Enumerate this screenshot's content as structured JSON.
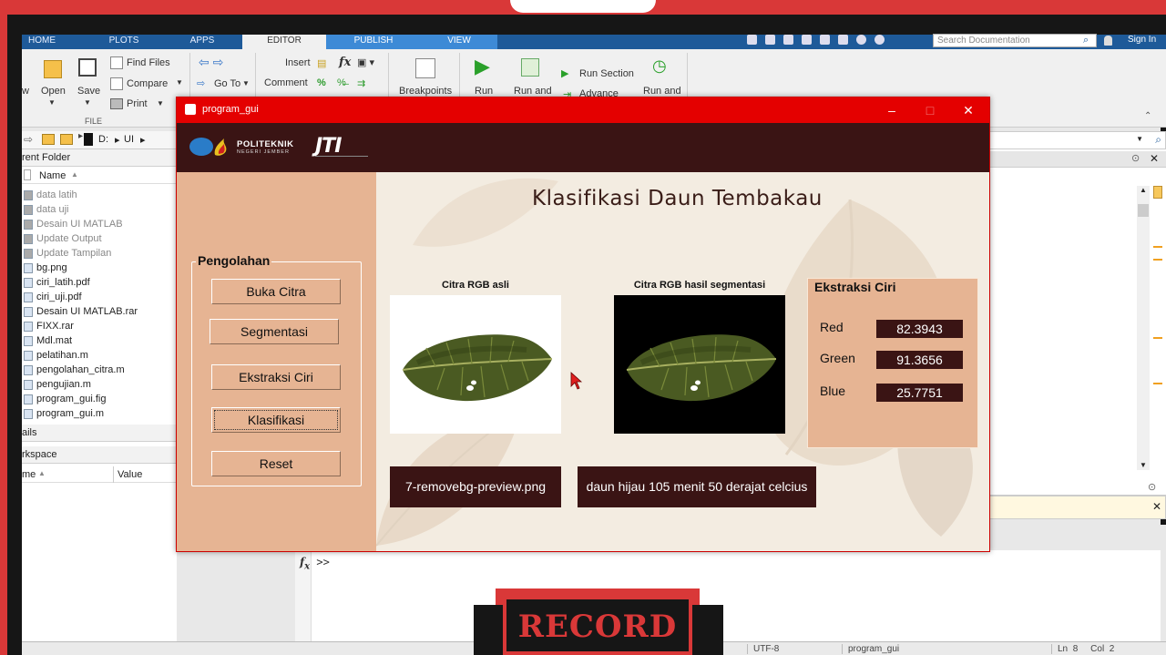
{
  "matlab": {
    "ribbon_tabs": [
      "HOME",
      "PLOTS",
      "APPS",
      "EDITOR",
      "PUBLISH",
      "VIEW"
    ],
    "search_placeholder": "Search Documentation",
    "sign_in": "Sign In",
    "file_group": {
      "new_partial": "w",
      "open": "Open",
      "save": "Save",
      "find_files": "Find Files",
      "compare": "Compare",
      "print": "Print",
      "group_label": "FILE"
    },
    "navigate": {
      "go_to": "Go To"
    },
    "edit": {
      "insert": "Insert",
      "comment": "Comment",
      "fx": "fx"
    },
    "breakpoints": "Breakpoints",
    "run": {
      "run": "Run",
      "run_and_advance": "Run and",
      "run_section": "Run Section",
      "advance": "Advance",
      "run_and_time": "Run and"
    },
    "address": {
      "drive": "D:",
      "folder": "UI"
    },
    "current_folder": {
      "header": "rent Folder",
      "name_col": "Name",
      "files": [
        {
          "name": "data latih",
          "style": "grey"
        },
        {
          "name": "data uji",
          "style": "grey"
        },
        {
          "name": "Desain UI MATLAB",
          "style": "grey"
        },
        {
          "name": "Update Output",
          "style": "grey"
        },
        {
          "name": "Update Tampilan",
          "style": "grey"
        },
        {
          "name": "bg.png",
          "style": "normal"
        },
        {
          "name": "ciri_latih.pdf",
          "style": "normal"
        },
        {
          "name": "ciri_uji.pdf",
          "style": "normal"
        },
        {
          "name": "Desain UI MATLAB.rar",
          "style": "normal"
        },
        {
          "name": "FIXX.rar",
          "style": "normal"
        },
        {
          "name": "Mdl.mat",
          "style": "normal"
        },
        {
          "name": "pelatihan.m",
          "style": "normal"
        },
        {
          "name": "pengolahan_citra.m",
          "style": "normal"
        },
        {
          "name": "pengujian.m",
          "style": "normal"
        },
        {
          "name": "program_gui.fig",
          "style": "normal"
        },
        {
          "name": "program_gui.m",
          "style": "normal"
        }
      ]
    },
    "details_header": "ails",
    "workspace": {
      "header": "rkspace",
      "name_col": "me",
      "value_col": "Value"
    },
    "command_prompt": ">>",
    "status": {
      "encoding": "UTF-8",
      "script": "program_gui",
      "ln_label": "Ln",
      "ln": "8",
      "col_label": "Col",
      "col": "2"
    }
  },
  "overlay": {
    "record_text": "RECORD"
  },
  "gui": {
    "window_title": "program_gui",
    "logo": {
      "polteknik_line1": "POLITEKNIK",
      "polteknik_line2": "NEGERI JEMBER",
      "jti": "JTI"
    },
    "title": "Klasifikasi  Daun Tembakau",
    "processing_group": {
      "title": "Pengolahan",
      "buttons": [
        "Buka Citra",
        "Segmentasi",
        "Ekstraksi Ciri",
        "Klasifikasi",
        "Reset"
      ]
    },
    "image_original": {
      "label": "Citra RGB asli"
    },
    "image_segmented": {
      "label": "Citra RGB hasil segmentasi"
    },
    "file_name": "7-removebg-preview.png",
    "classification_result": "daun hijau 105 menit 50 derajat celcius",
    "features": {
      "title": "Ekstraksi Ciri",
      "rows": [
        {
          "label": "Red",
          "value": "82.3943"
        },
        {
          "label": "Green",
          "value": "91.3656"
        },
        {
          "label": "Blue",
          "value": "25.7751"
        }
      ]
    }
  }
}
